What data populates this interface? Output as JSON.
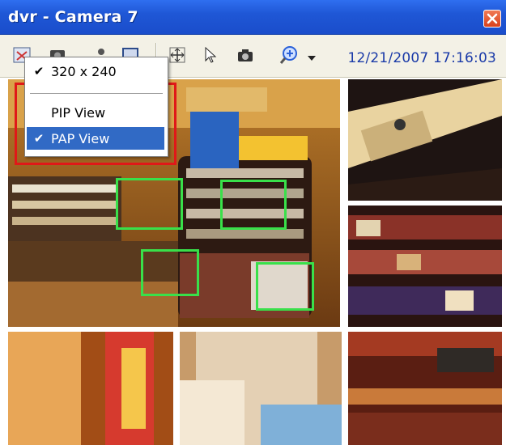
{
  "window": {
    "title": "dvr - Camera 7"
  },
  "toolbar": {
    "datetime": "12/21/2007  17:16:03",
    "icons": [
      "layout-icon",
      "record-icon",
      "person-icon",
      "display-icon",
      "fullscreen-icon",
      "pointer-icon",
      "snapshot-icon",
      "zoom-icon"
    ]
  },
  "menu": {
    "items": [
      {
        "label": "320 x 240",
        "checked": true
      },
      {
        "label": "PIP View",
        "checked": false
      },
      {
        "label": "PAP View",
        "checked": true,
        "selected": true
      }
    ],
    "check_glyph": "✔"
  },
  "colors": {
    "title_bar": "#1f57d6",
    "menu_highlight": "#316ac5",
    "annotation_red": "#e01818",
    "roi_green": "#39e04a"
  }
}
